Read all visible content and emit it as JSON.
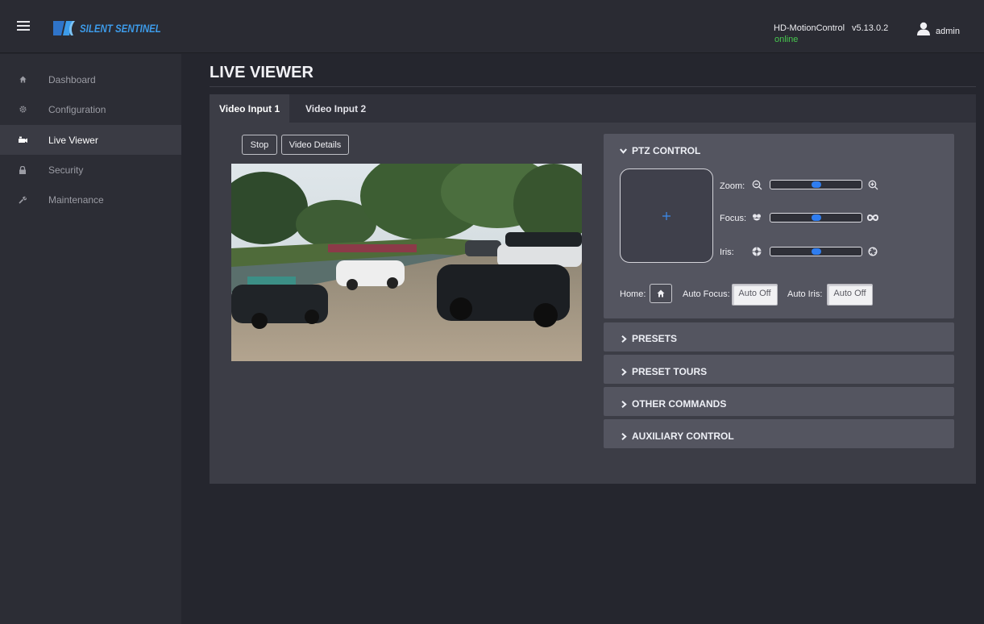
{
  "header": {
    "logo_text": "SILENT SENTINEL",
    "app_name": "HD-MotionControl",
    "version": "v5.13.0.2",
    "status": "online",
    "user": "admin"
  },
  "sidebar": {
    "items": [
      {
        "label": "Dashboard",
        "icon": "home-icon"
      },
      {
        "label": "Configuration",
        "icon": "gear-icon"
      },
      {
        "label": "Live Viewer",
        "icon": "camera-icon"
      },
      {
        "label": "Security",
        "icon": "lock-icon"
      },
      {
        "label": "Maintenance",
        "icon": "wrench-icon"
      }
    ]
  },
  "main": {
    "title": "LIVE VIEWER",
    "tabs": [
      {
        "label": "Video Input 1"
      },
      {
        "label": "Video Input 2"
      }
    ],
    "stop_label": "Stop",
    "details_label": "Video Details"
  },
  "ptz": {
    "title": "PTZ CONTROL",
    "zoom_label": "Zoom:",
    "focus_label": "Focus:",
    "iris_label": "Iris:",
    "zoom_level": 0.5,
    "focus_level": 0.5,
    "iris_level": 0.5,
    "home_label": "Home:",
    "auto_focus_label": "Auto Focus:",
    "auto_focus_value": "Auto Off",
    "auto_iris_label": "Auto Iris:",
    "auto_iris_value": "Auto Off"
  },
  "sections": [
    {
      "label": "PRESETS"
    },
    {
      "label": "PRESET TOURS"
    },
    {
      "label": "OTHER COMMANDS"
    },
    {
      "label": "AUXILIARY CONTROL"
    }
  ],
  "colors": {
    "accent": "#2f7df0",
    "online": "#47c84f",
    "logo": "#3d9be9"
  }
}
